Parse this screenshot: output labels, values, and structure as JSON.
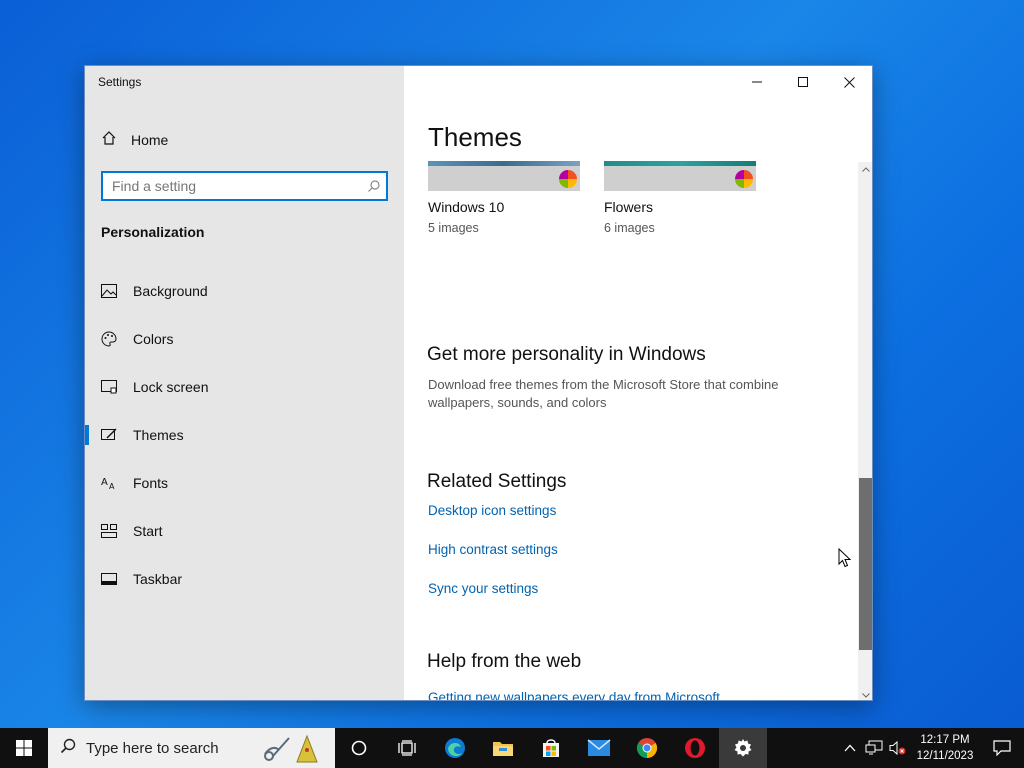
{
  "window": {
    "title": "Settings"
  },
  "sidebar": {
    "home_label": "Home",
    "search_placeholder": "Find a setting",
    "section_label": "Personalization",
    "items": [
      {
        "label": "Background",
        "icon": "image-icon"
      },
      {
        "label": "Colors",
        "icon": "palette-icon"
      },
      {
        "label": "Lock screen",
        "icon": "lock-screen-icon"
      },
      {
        "label": "Themes",
        "icon": "themes-icon",
        "active": true
      },
      {
        "label": "Fonts",
        "icon": "fonts-icon"
      },
      {
        "label": "Start",
        "icon": "start-icon"
      },
      {
        "label": "Taskbar",
        "icon": "taskbar-icon"
      }
    ]
  },
  "content": {
    "title": "Themes",
    "themes": [
      {
        "name": "Windows 10",
        "count": "5 images"
      },
      {
        "name": "Flowers",
        "count": "6 images"
      }
    ],
    "more": {
      "heading": "Get more personality in Windows",
      "description": "Download free themes from the Microsoft Store that combine wallpapers, sounds, and colors"
    },
    "related": {
      "heading": "Related Settings",
      "links": [
        "Desktop icon settings",
        "High contrast settings",
        "Sync your settings"
      ]
    },
    "help": {
      "heading": "Help from the web",
      "link": "Getting new wallpapers every day from Microsoft"
    }
  },
  "taskbar": {
    "search_placeholder": "Type here to search",
    "apps": [
      "cortana-icon",
      "task-view-icon",
      "edge-icon",
      "file-explorer-icon",
      "store-icon",
      "mail-icon",
      "chrome-icon",
      "opera-icon",
      "settings-icon"
    ],
    "time": "12:17 PM",
    "date": "12/11/2023"
  },
  "colors": {
    "accent": "#0078d7",
    "link": "#0063b1"
  }
}
